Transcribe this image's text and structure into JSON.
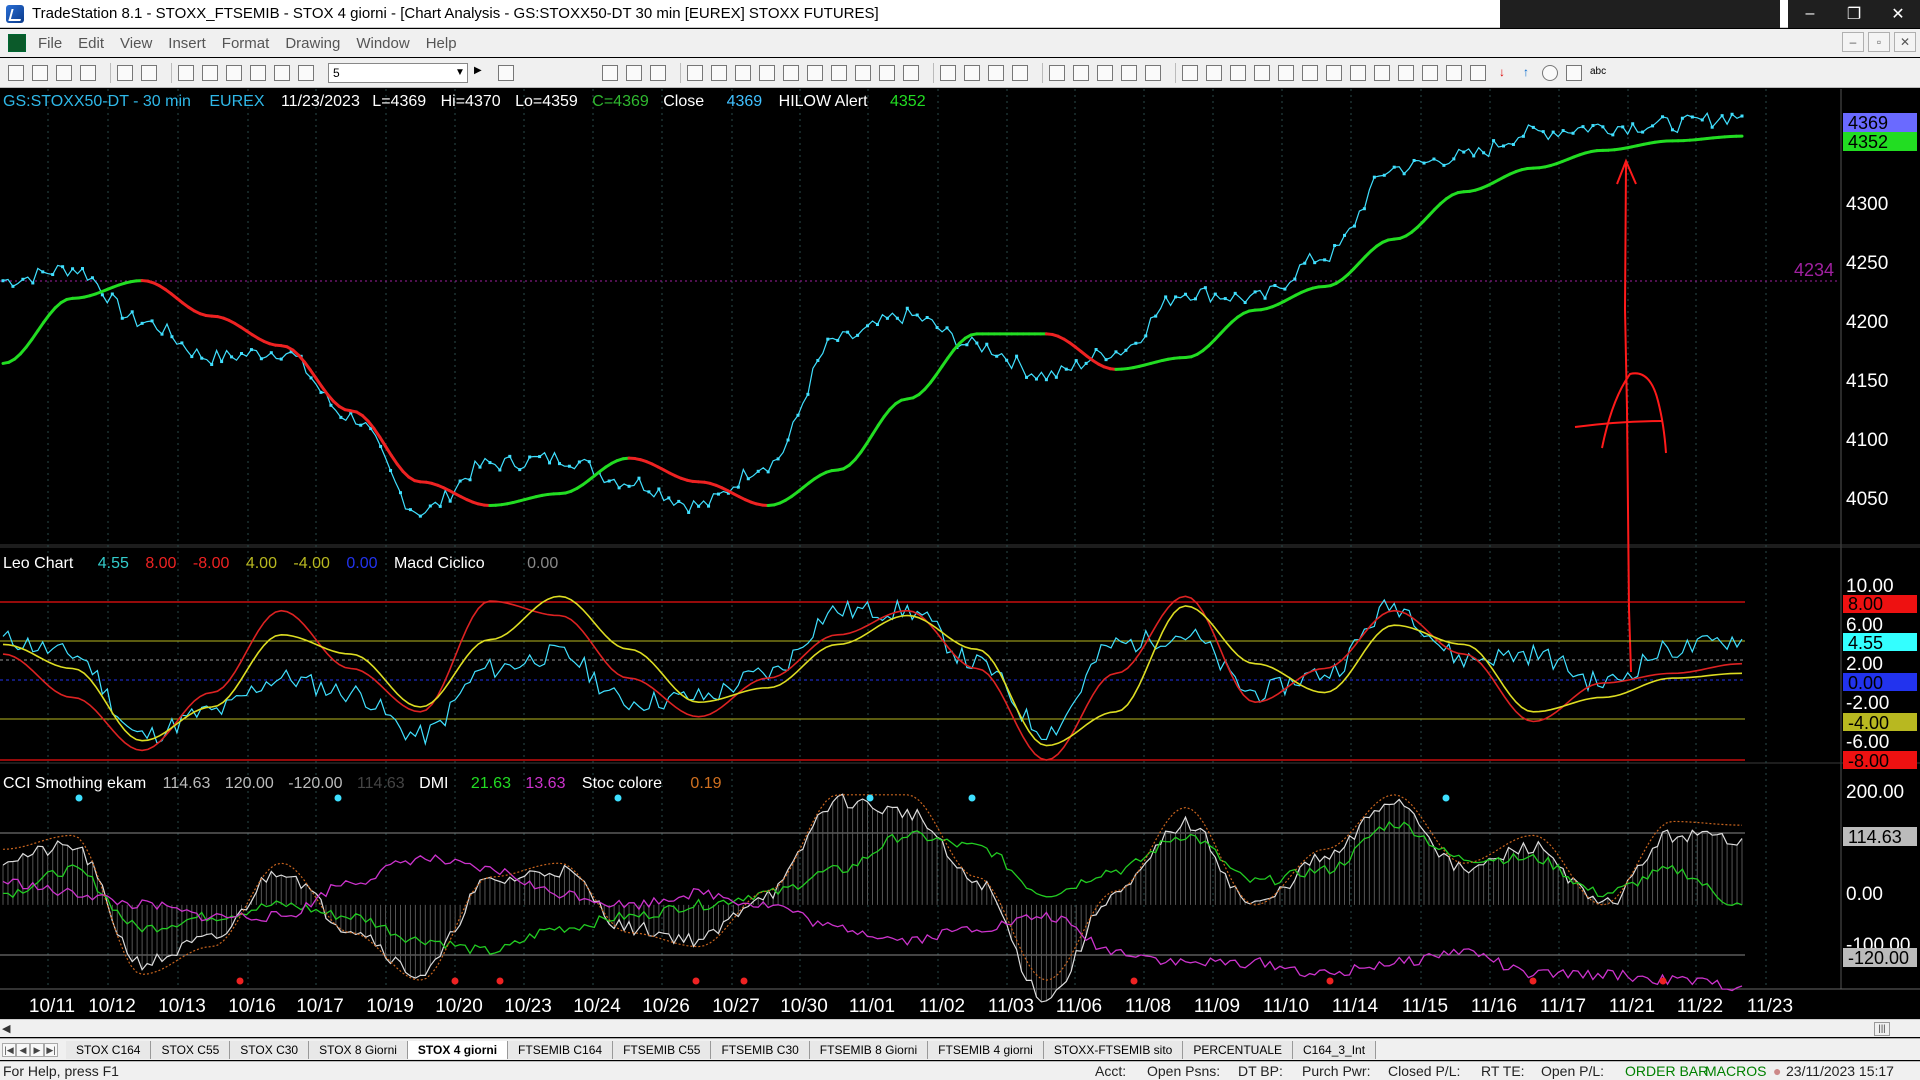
{
  "window": {
    "title": "TradeStation 8.1 - STOXX_FTSEMIB - STOX 4 giorni - [Chart Analysis - GS:STOXX50-DT  30 min  [EUREX] STOXX FUTURES]",
    "minimize": "‒",
    "restore": "❐",
    "close": "✕"
  },
  "menu": {
    "items": [
      "File",
      "Edit",
      "View",
      "Insert",
      "Format",
      "Drawing",
      "Window",
      "Help"
    ],
    "mdi": [
      "‒",
      "▫",
      "✕"
    ]
  },
  "toolbar": {
    "interval_value": "5"
  },
  "price_pane": {
    "legend": {
      "symbol": "GS:STOXX50-DT - 30 min",
      "exchange": "EUREX",
      "date": "11/23/2023",
      "last": "L=4369",
      "hi": "Hi=4370",
      "lo": "Lo=4359",
      "close": "C=4369",
      "close_label": "Close",
      "close_value": "4369",
      "alert_label": "HILOW Alert",
      "alert_value": "4352"
    },
    "axis_ticks": [
      "4300",
      "4250",
      "4200",
      "4150",
      "4100",
      "4050"
    ],
    "tag_price": "4369",
    "tag_alert": "4352",
    "ref_line_label": "4234"
  },
  "leo_pane": {
    "legend": {
      "name": "Leo Chart",
      "v1": "4.55",
      "v2": "8.00",
      "v3": "-8.00",
      "v4": "4.00",
      "v5": "-4.00",
      "v6": "0.00",
      "name2": "Macd Ciclico",
      "v7": "0.00"
    },
    "axis_ticks": [
      "10.00",
      "6.00",
      "2.00",
      "-2.00",
      "-6.00"
    ],
    "tags": [
      "8.00",
      "4.55",
      "0.00",
      "-4.00",
      "-8.00"
    ]
  },
  "cci_pane": {
    "legend": {
      "name": "CCI Smothing ekam",
      "v1": "114.63",
      "v2": "120.00",
      "v3": "-120.00",
      "v4": "114.63",
      "dmi": "DMI",
      "dmi_plus": "21.63",
      "dmi_minus": "13.63",
      "stoc": "Stoc colore",
      "stoc_value": "0.19"
    },
    "axis_ticks": [
      "200.00",
      "0.00",
      "-100.00"
    ],
    "tags": [
      "114.63",
      "-120.00"
    ]
  },
  "time_axis": [
    "10/11",
    "10/12",
    "10/13",
    "10/16",
    "10/17",
    "10/19",
    "10/20",
    "10/23",
    "10/24",
    "10/26",
    "10/27",
    "10/30",
    "11/01",
    "11/02",
    "11/03",
    "11/06",
    "11/08",
    "11/09",
    "11/10",
    "11/14",
    "11/15",
    "11/16",
    "11/17",
    "11/21",
    "11/22",
    "11/23"
  ],
  "tabs": [
    "STOX C164",
    "STOX C55",
    "STOX  C30",
    "STOX  8 Giorni",
    "STOX 4 giorni",
    "FTSEMIB C164",
    "FTSEMIB C55",
    "FTSEMIB C30",
    "FTSEMIB  8 Giorni",
    "FTSEMIB  4 giorni",
    "STOXX-FTSEMIB sito",
    "PERCENTUALE",
    "C164_3_Int"
  ],
  "active_tab": "STOX 4 giorni",
  "status": {
    "help": "For Help, press F1",
    "acct": "Acct:",
    "open_psns": "Open Psns:",
    "dt_bp": "DT BP:",
    "purch_pwr": "Purch Pwr:",
    "closed_pl": "Closed P/L:",
    "rt_te": "RT TE:",
    "open_pl": "Open P/L:",
    "order_bar": "ORDER BAR",
    "macros": "MACROS",
    "datetime": "23/11/2023 15:17"
  },
  "colors": {
    "price": "#40e0ff",
    "ma_up": "#22dd22",
    "ma_down": "#ee2222",
    "magenta": "#cc33cc",
    "annotation": "#ff1a1a",
    "tag_blue": "#6a6aff"
  },
  "chart_data": [
    {
      "type": "line",
      "title": "GS:STOXX50-DT - 30 min",
      "categories": [
        "10/11",
        "10/12",
        "10/13",
        "10/16",
        "10/17",
        "10/19",
        "10/20",
        "10/23",
        "10/24",
        "10/26",
        "10/27",
        "10/30",
        "11/01",
        "11/02",
        "11/03",
        "11/06",
        "11/08",
        "11/09",
        "11/10",
        "11/14",
        "11/15",
        "11/16",
        "11/17",
        "11/21",
        "11/22",
        "11/23"
      ],
      "series": [
        {
          "values": [
            4230,
            4240,
            4195,
            4165,
            4170,
            4115,
            4035,
            4075,
            4080,
            4060,
            4040,
            4075,
            4180,
            4200,
            4175,
            4150,
            4170,
            4220,
            4215,
            4250,
            4325,
            4335,
            4355,
            4360,
            4362,
            4369
          ]
        },
        {
          "values": [
            4160,
            4215,
            4230,
            4200,
            4175,
            4120,
            4060,
            4040,
            4050,
            4080,
            4060,
            4040,
            4070,
            4130,
            4185,
            4185,
            4155,
            4165,
            4205,
            4225,
            4265,
            4305,
            4325,
            4340,
            4348,
            4352
          ]
        }
      ],
      "ylim": [
        4010,
        4380
      ]
    },
    {
      "type": "line",
      "title": "Leo Chart",
      "categories": [
        "10/11",
        "10/12",
        "10/13",
        "10/16",
        "10/17",
        "10/19",
        "10/20",
        "10/23",
        "10/24",
        "10/26",
        "10/27",
        "10/30",
        "11/01",
        "11/02",
        "11/03",
        "11/06",
        "11/08",
        "11/09",
        "11/10",
        "11/14",
        "11/15",
        "11/16",
        "11/17",
        "11/21",
        "11/22",
        "11/23"
      ],
      "series": [
        {
          "values": [
            4.5,
            3.0,
            -5.5,
            -3.0,
            0.5,
            -1.0,
            -5.5,
            1.5,
            3.0,
            -2.0,
            -1.5,
            1.0,
            7.5,
            7.5,
            2.0,
            -5.0,
            4.0,
            5.0,
            -1.0,
            1.0,
            8.0,
            2.5,
            3.0,
            0.0,
            3.5,
            4.55
          ]
        },
        {
          "values": [
            3.0,
            -1.5,
            -7.0,
            -1.0,
            7.5,
            1.5,
            -3.0,
            8.5,
            7.0,
            0.5,
            -3.5,
            0.5,
            5.0,
            7.5,
            1.5,
            -8.0,
            1.0,
            9.0,
            -2.0,
            1.5,
            7.5,
            3.0,
            -4.0,
            0.0,
            1.0,
            2.0
          ]
        },
        {
          "values": [
            4.0,
            1.5,
            -6.0,
            -2.5,
            5.0,
            3.0,
            -2.5,
            4.5,
            9.0,
            3.5,
            -2.0,
            -0.5,
            4.0,
            7.0,
            3.5,
            -6.5,
            -3.0,
            8.0,
            2.0,
            -1.0,
            6.0,
            4.0,
            -3.0,
            -1.5,
            0.5,
            1.0
          ]
        }
      ],
      "ylim": [
        -8,
        10
      ]
    },
    {
      "type": "line",
      "title": "CCI Smothing ekam",
      "categories": [
        "10/11",
        "10/12",
        "10/13",
        "10/16",
        "10/17",
        "10/19",
        "10/20",
        "10/23",
        "10/24",
        "10/26",
        "10/27",
        "10/30",
        "11/01",
        "11/02",
        "11/03",
        "11/06",
        "11/08",
        "11/09",
        "11/10",
        "11/14",
        "11/15",
        "11/16",
        "11/17",
        "11/21",
        "11/22",
        "11/23"
      ],
      "series": [
        {
          "values": [
            80,
            100,
            -100,
            -60,
            60,
            -40,
            -120,
            40,
            60,
            -40,
            -60,
            20,
            180,
            160,
            40,
            -160,
            20,
            140,
            0,
            80,
            180,
            60,
            100,
            0,
            120,
            114.63
          ]
        },
        {
          "values": [
            20,
            60,
            -40,
            -20,
            0,
            -20,
            -60,
            -80,
            -40,
            -20,
            0,
            20,
            60,
            120,
            100,
            20,
            60,
            120,
            40,
            60,
            140,
            80,
            80,
            20,
            60,
            0
          ]
        },
        {
          "values": [
            40,
            20,
            0,
            -20,
            -20,
            40,
            80,
            60,
            20,
            0,
            20,
            0,
            -40,
            -60,
            -40,
            -20,
            -80,
            -100,
            -100,
            -120,
            -100,
            -80,
            -120,
            -120,
            -130,
            -140
          ]
        }
      ],
      "ylim": [
        -140,
        200
      ]
    }
  ]
}
